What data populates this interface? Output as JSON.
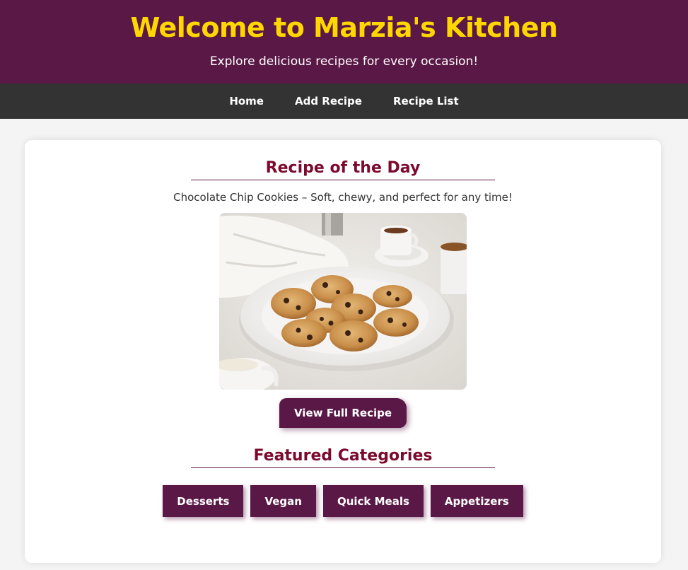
{
  "header": {
    "title": "Welcome to Marzia's Kitchen",
    "subtitle": "Explore delicious recipes for every occasion!"
  },
  "nav": {
    "items": [
      "Home",
      "Add Recipe",
      "Recipe List"
    ]
  },
  "recipe_of_day": {
    "heading": "Recipe of the Day",
    "description": "Chocolate Chip Cookies – Soft, chewy, and perfect for any time!",
    "button_label": "View Full Recipe"
  },
  "featured": {
    "heading": "Featured Categories",
    "categories": [
      "Desserts",
      "Vegan",
      "Quick Meals",
      "Appetizers"
    ]
  },
  "colors": {
    "header_bg": "#5a1846",
    "title": "#ffd700",
    "nav_bg": "#333333",
    "heading": "#7b0a2e"
  }
}
